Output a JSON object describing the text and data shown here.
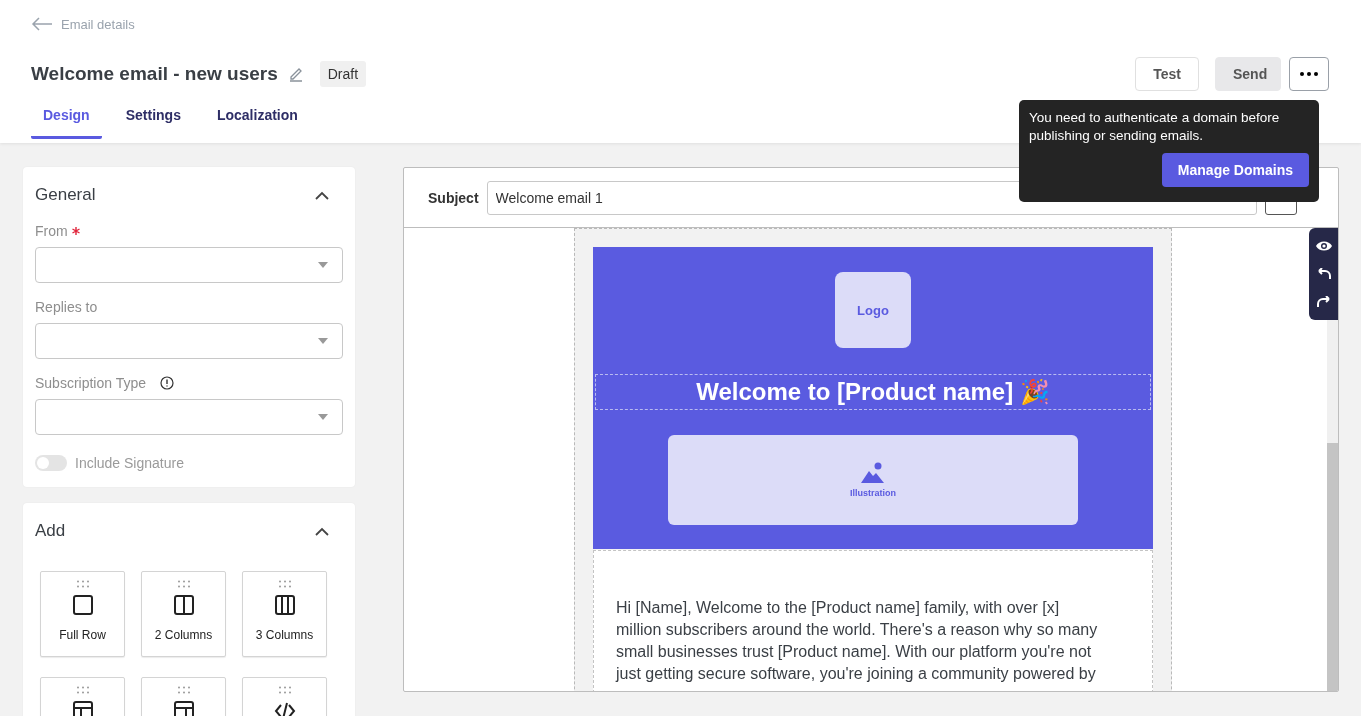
{
  "back_link": {
    "label": "Email details"
  },
  "title": "Welcome email - new users",
  "status_badge": "Draft",
  "actions": [
    {
      "label": "Test",
      "kind": "outline"
    },
    {
      "label": "Send",
      "kind": "filled"
    }
  ],
  "tabs": [
    {
      "label": "Design",
      "selected": true
    },
    {
      "label": "Settings",
      "selected": false
    },
    {
      "label": "Localization",
      "selected": false
    }
  ],
  "tooltip": {
    "message": "You need to authenticate a domain before publishing or sending emails.",
    "button": "Manage Domains"
  },
  "general": {
    "title": "General",
    "expanded": true,
    "fields": [
      {
        "label": "From",
        "required": true,
        "info": false
      },
      {
        "label": "Replies to",
        "required": false,
        "info": false
      },
      {
        "label": "Subscription Type",
        "required": false,
        "info": true
      }
    ],
    "toggle": {
      "label": "Include Signature",
      "on": false
    }
  },
  "add": {
    "title": "Add",
    "expanded": true,
    "blocks": [
      {
        "label": "Full Row",
        "kind": "full"
      },
      {
        "label": "2 Columns",
        "kind": "two"
      },
      {
        "label": "3 Columns",
        "kind": "three"
      },
      {
        "kind": "left"
      },
      {
        "kind": "right"
      },
      {
        "kind": "code"
      }
    ]
  },
  "subject": {
    "label": "Subject",
    "value": "Welcome email 1"
  },
  "email": {
    "logo": "Logo",
    "heading": "Welcome to [Product name] 🎉",
    "illustration": "Illustration",
    "body_lines": [
      "Hi [Name],  Welcome to the [Product name] family, with over [x]",
      "million subscribers around the world. There's a reason why so many",
      "small businesses trust [Product name]. With our platform you're not",
      "just getting secure software, you're joining a community powered by"
    ]
  }
}
